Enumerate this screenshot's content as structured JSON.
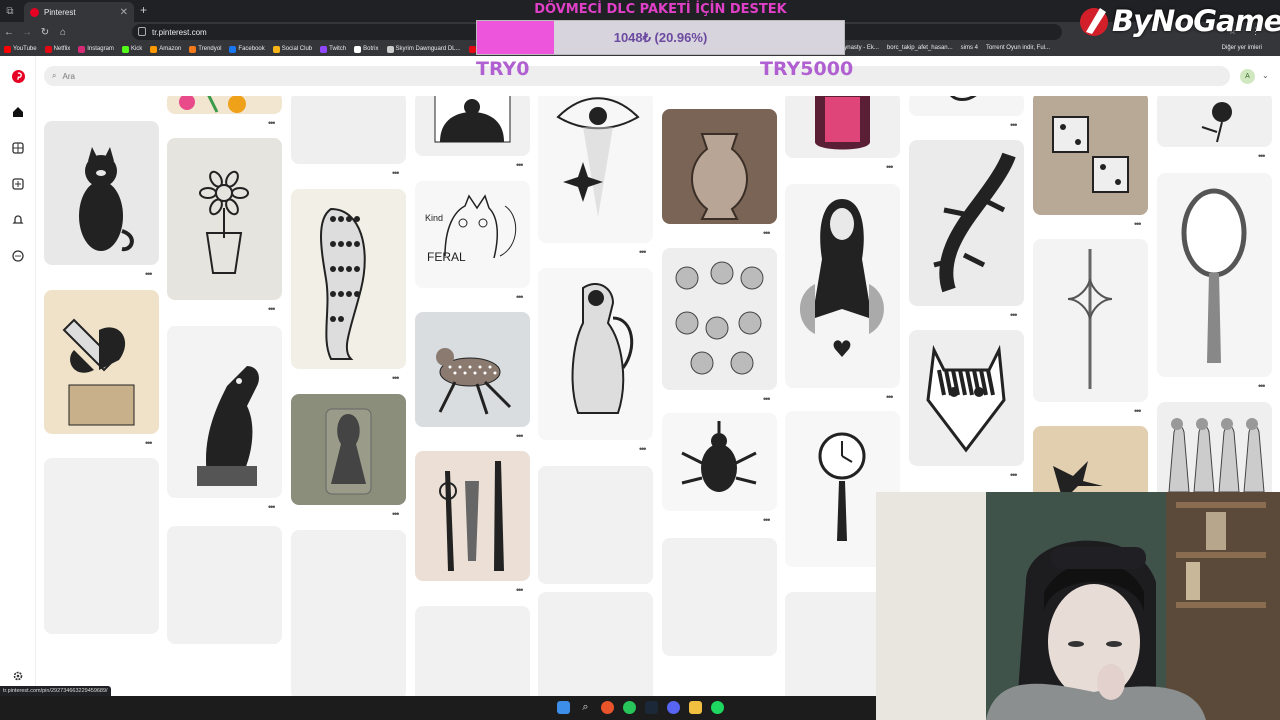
{
  "browser": {
    "tab_title": "Pinterest",
    "address": "tr.pinterest.com",
    "bookmarks": [
      "YouTube",
      "Netflix",
      "Instagram",
      "Kick",
      "Amazon",
      "Trendyol",
      "Facebook",
      "Social Club",
      "Twitch",
      "Botrix",
      "Skyrim Dawnguard DL...",
      "The E"
    ],
    "bookmarks_right": [
      "Medieval Dynasty - Ek...",
      "borc_takip_afet_hasan...",
      "sims 4",
      "Torrent Oyun indir, Ful..."
    ],
    "other_bookmarks": "Diğer yer imleri",
    "status_url": "tr.pinterest.com/pin/292734663229459689/"
  },
  "overlay": {
    "donation_title": "DÖVMECİ DLC PAKETİ İÇİN DESTEK",
    "donation_progress_text": "1048₺ (20.96%)",
    "donation_progress_fraction": 0.2096,
    "goal_min": "TRY0",
    "goal_max": "TRY5000",
    "brand": "ByNoGame"
  },
  "pinterest": {
    "search_placeholder": "Ara",
    "avatar_letter": "A"
  },
  "colors": {
    "pinterest_red": "#e60023",
    "donation_pink": "#ee55dd",
    "donation_text": "#6b4aa0",
    "try_label": "#b060d0"
  },
  "pins": [
    {
      "name": "pin-flowers-top",
      "alt": "colorful flowers"
    },
    {
      "name": "pin-cat-tattoo",
      "alt": "black cat"
    },
    {
      "name": "pin-daisy-vase",
      "alt": "daisy in vase"
    },
    {
      "name": "pin-butterfly-axe",
      "alt": "butterfly axe on stump"
    },
    {
      "name": "pin-horse-chess",
      "alt": "chess knight horse"
    },
    {
      "name": "pin-warrior-horse",
      "alt": "rider sketch"
    },
    {
      "name": "pin-leopard",
      "alt": "leopard"
    },
    {
      "name": "pin-knight-card",
      "alt": "knight card"
    },
    {
      "name": "pin-cathedral",
      "alt": "cathedral"
    },
    {
      "name": "pin-kind-of-feral",
      "alt": "kind of feral cat"
    },
    {
      "name": "pin-fawn",
      "alt": "fawn"
    },
    {
      "name": "pin-daggers",
      "alt": "ornamental daggers"
    },
    {
      "name": "pin-eye-star",
      "alt": "eye and star"
    },
    {
      "name": "pin-angel-statue",
      "alt": "angel statue"
    },
    {
      "name": "pin-urn",
      "alt": "urn"
    },
    {
      "name": "pin-sketch-sheet",
      "alt": "sketch sheet"
    },
    {
      "name": "pin-beetle",
      "alt": "beetle"
    },
    {
      "name": "pin-stained-glass",
      "alt": "stained glass"
    },
    {
      "name": "pin-moth-woman",
      "alt": "moth woman"
    },
    {
      "name": "pin-mirror-clock",
      "alt": "clock mirror"
    },
    {
      "name": "pin-lizard",
      "alt": "lizard"
    },
    {
      "name": "pin-tiger",
      "alt": "tiger"
    },
    {
      "name": "pin-dice-tattoo",
      "alt": "dice tattoo"
    },
    {
      "name": "pin-ornament-dagger",
      "alt": "ornamental dagger"
    },
    {
      "name": "pin-bird",
      "alt": "bird"
    },
    {
      "name": "pin-rose",
      "alt": "rose"
    },
    {
      "name": "pin-hand-mirror",
      "alt": "hand mirror"
    },
    {
      "name": "pin-figures",
      "alt": "figures sheet"
    }
  ]
}
